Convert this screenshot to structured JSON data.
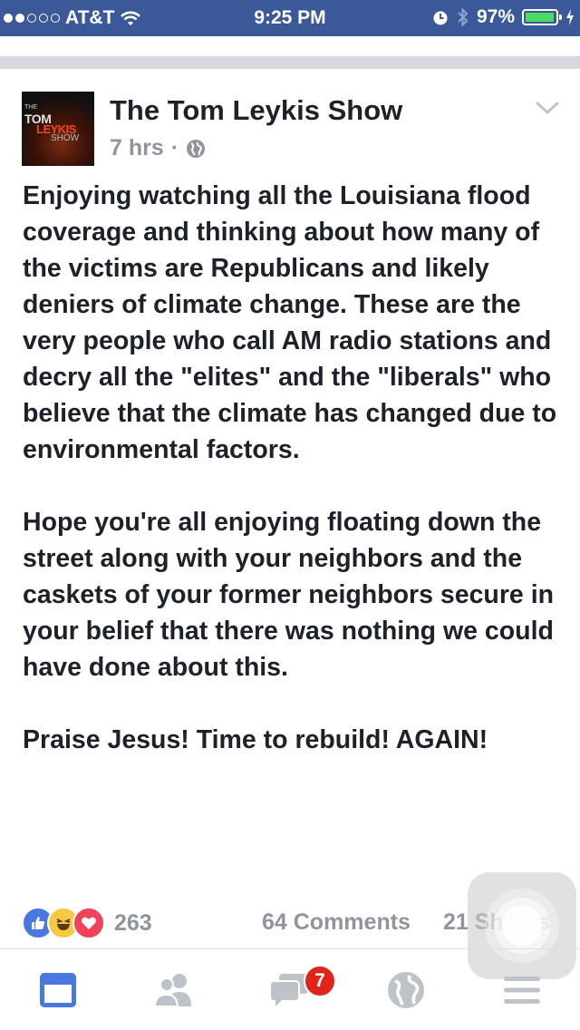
{
  "status_bar": {
    "carrier": "AT&T",
    "time": "9:25 PM",
    "battery_percent": "97%",
    "signal_bars_filled": 2,
    "signal_bars_total": 5,
    "battery_level": 0.97
  },
  "post": {
    "page_name": "The Tom Leykis Show",
    "timestamp": "7 hrs",
    "separator": "·",
    "privacy_icon": "globe-icon",
    "avatar": {
      "line1": "THE",
      "line2": "TOM",
      "line3": "LEYKIS",
      "line4": "SHOW"
    },
    "paragraphs": [
      "Enjoying watching all the Louisiana flood coverage and thinking about how many of the victims are Republicans and likely deniers of climate change. These are the very people who call AM radio stations and decry all the \"elites\" and the \"liberals\" who believe that the climate has changed due to environmental factors.",
      "Hope you're all enjoying floating down the street along with your neighbors and the caskets of your former neighbors secure in your belief that there was nothing we could have done about this.",
      "Praise Jesus! Time to rebuild! AGAIN!"
    ],
    "reactions_count": "263",
    "comments": "64 Comments",
    "shares": "21 Shares"
  },
  "tab_bar": {
    "items": [
      "news-feed-icon",
      "friends-icon",
      "messages-icon",
      "globe-icon",
      "menu-icon"
    ],
    "messages_badge": "7"
  },
  "colors": {
    "brand": "#3b5998",
    "active_tab": "#4267b2",
    "inactive_tab": "#bec3c9",
    "meta_text": "#90949c",
    "badge": "#e0241c"
  }
}
